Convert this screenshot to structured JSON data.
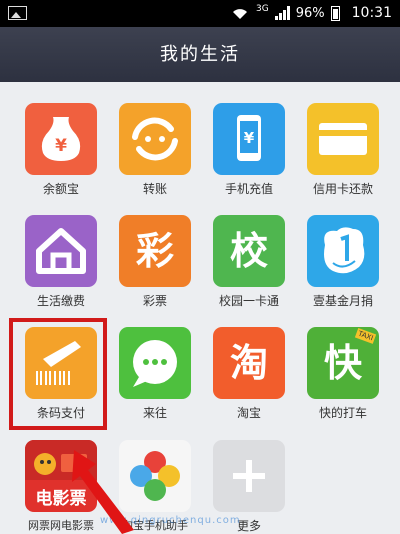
{
  "status": {
    "network": "3G",
    "battery": "96%",
    "time": "10:31"
  },
  "header": {
    "title": "我的生活"
  },
  "apps": [
    {
      "label": "余额宝",
      "glyph": ""
    },
    {
      "label": "转账",
      "glyph": ""
    },
    {
      "label": "手机充值",
      "glyph": ""
    },
    {
      "label": "信用卡还款",
      "glyph": ""
    },
    {
      "label": "生活缴费",
      "glyph": ""
    },
    {
      "label": "彩票",
      "glyph": "彩"
    },
    {
      "label": "校园一卡通",
      "glyph": "校"
    },
    {
      "label": "壹基金月捐",
      "glyph": ""
    },
    {
      "label": "条码支付",
      "glyph": ""
    },
    {
      "label": "来往",
      "glyph": ""
    },
    {
      "label": "淘宝",
      "glyph": "淘"
    },
    {
      "label": "快的打车",
      "glyph": "快"
    },
    {
      "label": "网票网电影票",
      "glyph": "电影票"
    },
    {
      "label": "淘宝手机助手",
      "glyph": ""
    },
    {
      "label": "更多",
      "glyph": ""
    }
  ],
  "badges": {
    "wallet_symbol": "¥",
    "phone_symbol": "¥",
    "taxi": "TAXI"
  },
  "watermark": "www.qingruchenqu.com",
  "colors": {
    "statusbar": "#000000",
    "titlebar": "#353948",
    "yuebao": "#f0603f",
    "zhuanzhang": "#f4a22a",
    "recharge": "#2e9ee8",
    "creditcard": "#f4c12a",
    "utility": "#9a63c8",
    "lottery": "#f07e28",
    "campus": "#4fb64f",
    "onefoundation": "#2ea7e8",
    "barcode": "#f4a22a",
    "laiwang": "#4ec03e",
    "taobao": "#f25d2c",
    "kuaidi": "#4fb038",
    "movie": "#e0312c",
    "highlight": "#d11a1a"
  }
}
